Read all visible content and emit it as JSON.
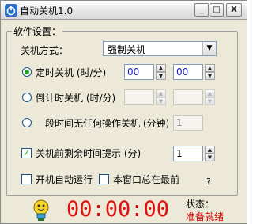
{
  "window": {
    "title": "自动关机1.0",
    "icons": {
      "app": "power-icon"
    },
    "controls": {
      "minimize": "_",
      "maximize": "□",
      "close": "X"
    }
  },
  "settings": {
    "group_title": "软件设置：",
    "shutdown_mode": {
      "label": "关机方式：",
      "value": "强制关机"
    },
    "timed_shutdown": {
      "label": "定时关机 (时/分)",
      "hour": "00",
      "minute": "00",
      "selected": true
    },
    "countdown_shutdown": {
      "label": "倒计时关机 (时/分)",
      "hour": "",
      "minute": "",
      "selected": false
    },
    "idle_shutdown": {
      "label": "一段时间无任何操作关机 (分钟)",
      "minutes": "1",
      "selected": false
    },
    "remaining_hint": {
      "label": "关机前剩余时间提示 (分)",
      "minutes": "1",
      "checked": true
    },
    "autostart": {
      "label": "开机自动运行",
      "checked": false
    },
    "always_on_top": {
      "label": "本窗口总在最前",
      "checked": false
    },
    "help": "?"
  },
  "footer": {
    "timer": "00:00:00",
    "status_label": "状态：",
    "status_value": "准备就绪"
  },
  "colors": {
    "timer": "#e01010",
    "status": "#d40000",
    "window_bg": "#ECE9D8"
  }
}
